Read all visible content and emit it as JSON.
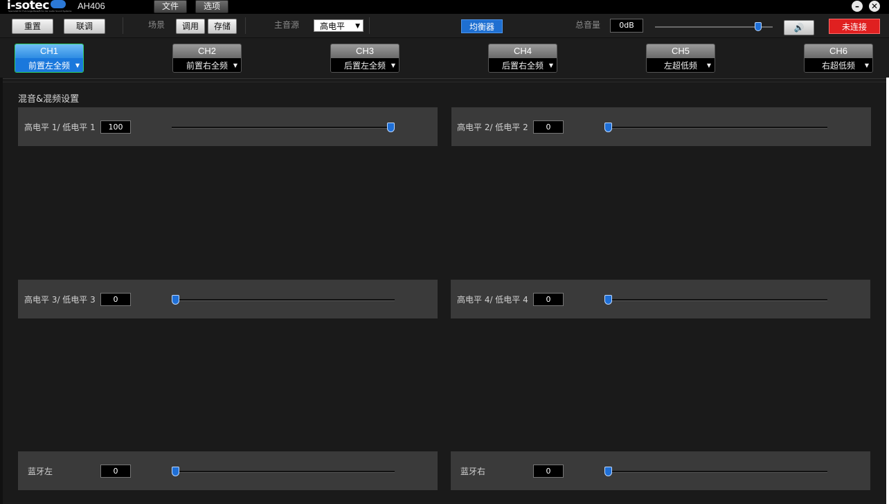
{
  "titlebar": {
    "logo_text": "i-sotec",
    "logo_tagline": "Specialist for Full-range Bass/Echo Car Audio Sound Systems",
    "model": "AH406",
    "menus": [
      "文件",
      "选项"
    ]
  },
  "toolbar": {
    "reset_label": "重置",
    "link_label": "联调",
    "scene_label": "场景",
    "recall_label": "调用",
    "save_label": "存储",
    "source_label": "主音源",
    "source_value": "高电平",
    "eq_label": "均衡器",
    "master_volume_label": "总音量",
    "master_volume_value": "0dB",
    "master_volume_level": 0.9,
    "connection_label": "未连接"
  },
  "channels": [
    {
      "name": "CH1",
      "assign": "前置左全频",
      "active": true
    },
    {
      "name": "CH2",
      "assign": "前置右全频",
      "active": false
    },
    {
      "name": "CH3",
      "assign": "后置左全频",
      "active": false
    },
    {
      "name": "CH4",
      "assign": "后置右全频",
      "active": false
    },
    {
      "name": "CH5",
      "assign": "左超低频",
      "active": false
    },
    {
      "name": "CH6",
      "assign": "右超低频",
      "active": false
    }
  ],
  "mixer": {
    "title": "混音&混频设置",
    "controls": [
      {
        "label": "高电平 1/ 低电平 1",
        "value": "100",
        "level": 1.0
      },
      {
        "label": "高电平 2/ 低电平 2",
        "value": "0",
        "level": 0.0
      },
      {
        "label": "高电平 3/ 低电平 3",
        "value": "0",
        "level": 0.0
      },
      {
        "label": "高电平 4/ 低电平 4",
        "value": "0",
        "level": 0.0
      },
      {
        "label": "蓝牙左",
        "value": "0",
        "level": 0.0
      },
      {
        "label": "蓝牙右",
        "value": "0",
        "level": 0.0
      }
    ]
  }
}
